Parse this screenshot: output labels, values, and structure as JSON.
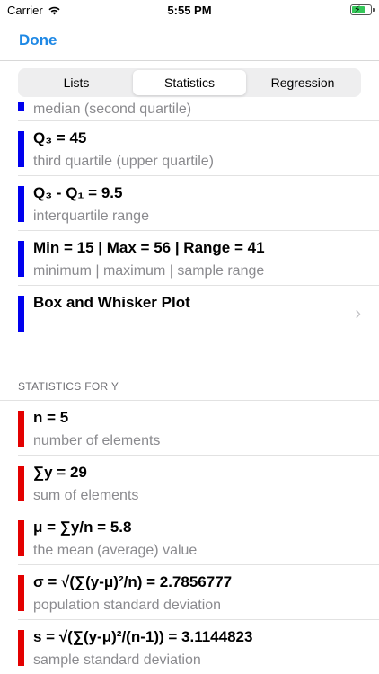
{
  "status_bar": {
    "carrier": "Carrier",
    "time": "5:55 PM",
    "battery_level": 0.7
  },
  "nav": {
    "done_label": "Done"
  },
  "tabs": [
    {
      "label": "Lists",
      "active": false
    },
    {
      "label": "Statistics",
      "active": true
    },
    {
      "label": "Regression",
      "active": false
    }
  ],
  "x_rows": [
    {
      "title": "",
      "subtitle": "median (second quartile)"
    },
    {
      "title": "Q₃ = 45",
      "subtitle": "third quartile (upper quartile)"
    },
    {
      "title": "Q₃ - Q₁ = 9.5",
      "subtitle": "interquartile range"
    },
    {
      "title": "Min = 15 | Max = 56 | Range = 41",
      "subtitle": "minimum | maximum | sample range"
    },
    {
      "title": "Box and Whisker Plot",
      "subtitle": ""
    }
  ],
  "section_y": {
    "header": "STATISTICS FOR Y"
  },
  "y_rows": [
    {
      "title": "n = 5",
      "subtitle": "number of elements"
    },
    {
      "title": "∑y = 29",
      "subtitle": "sum of elements"
    },
    {
      "title": "μ = ∑y/n = 5.8",
      "subtitle": "the mean (average) value"
    },
    {
      "title": "σ = √(∑(y-μ)²/n) =  2.7856777",
      "subtitle": "population standard deviation"
    },
    {
      "title": "s = √(∑(y-μ)²/(n-1)) = 3.1144823",
      "subtitle": "sample standard deviation"
    }
  ],
  "colors": {
    "x_marker": "#0000ee",
    "y_marker": "#e30000",
    "accent": "#1e88e5"
  }
}
